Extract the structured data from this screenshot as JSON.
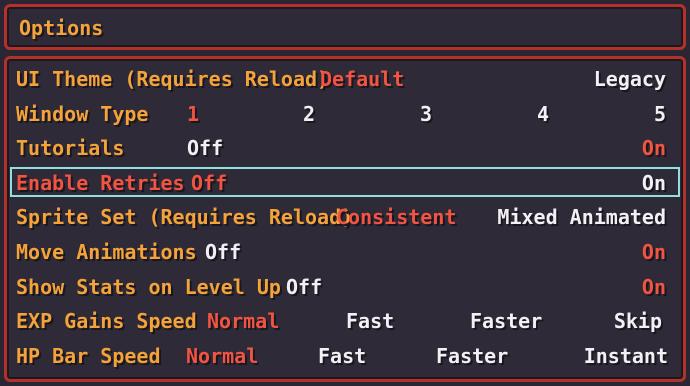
{
  "header": {
    "title": "Options"
  },
  "rows": [
    {
      "label": "UI Theme (Requires Reload)",
      "options": [
        "Default",
        "Legacy"
      ],
      "selected": 0
    },
    {
      "label": "Window Type",
      "options": [
        "1",
        "2",
        "3",
        "4",
        "5"
      ],
      "selected": 0
    },
    {
      "label": "Tutorials",
      "options": [
        "Off",
        "On"
      ],
      "selected": 1
    },
    {
      "label": "Enable Retries",
      "options": [
        "Off",
        "On"
      ],
      "selected": 0,
      "focused": true
    },
    {
      "label": "Sprite Set (Requires Reload)",
      "options": [
        "Consistent",
        "Mixed Animated"
      ],
      "selected": 0
    },
    {
      "label": "Move Animations",
      "options": [
        "Off",
        "On"
      ],
      "selected": 1
    },
    {
      "label": "Show Stats on Level Up",
      "options": [
        "Off",
        "On"
      ],
      "selected": 1
    },
    {
      "label": "EXP Gains Speed",
      "options": [
        "Normal",
        "Fast",
        "Faster",
        "Skip"
      ],
      "selected": 0
    },
    {
      "label": "HP Bar Speed",
      "options": [
        "Normal",
        "Fast",
        "Faster",
        "Instant"
      ],
      "selected": 0
    }
  ],
  "colors": {
    "label": "#f3a33a",
    "selected": "#f25442",
    "unselected": "#f2f0f4",
    "frame_border": "#b2312b",
    "focus_outline": "#8fe0df"
  }
}
